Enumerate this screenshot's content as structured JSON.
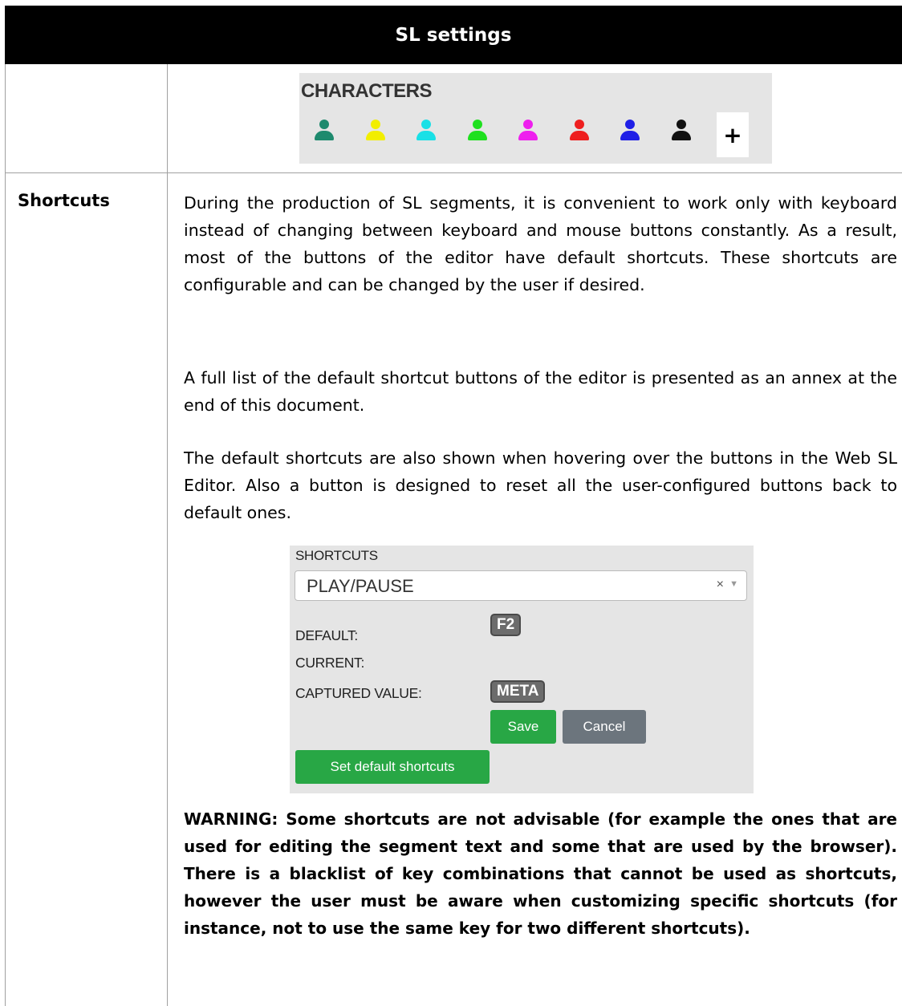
{
  "header": {
    "title": "SL settings"
  },
  "characters": {
    "title": "CHARACTERS",
    "icon": "user-icon",
    "colors": [
      "#1e8a6e",
      "#f2ee00",
      "#19e0e6",
      "#1fe01f",
      "#ee1fee",
      "#ee1f1f",
      "#1f1fe6",
      "#111111"
    ],
    "add_label": "+"
  },
  "shortcuts_row": {
    "label": "Shortcuts",
    "paragraphs": [
      "During the production of SL segments, it is convenient to work only with keyboard instead of changing between keyboard and mouse buttons constantly. As a result, most of the buttons of the editor have default shortcuts. These shortcuts are configurable and can be changed by the user if desired.",
      "A full list of the default shortcut buttons of the editor is presented as an annex at the end of this document.",
      "The default shortcuts are also shown when hovering over the buttons in the Web SL Editor. Also a button is designed to reset all the user-configured buttons back to default ones."
    ],
    "warning": "WARNING: Some shortcuts are not advisable (for example the ones that are used for editing the segment text and some that are used by the browser). There is a blacklist of key combinations that cannot be used as shortcuts, however the user must be aware when customizing specific shortcuts (for instance, not to use the same key for two different shortcuts)."
  },
  "shortcuts_panel": {
    "title": "SHORTCUTS",
    "selected": "PLAY/PAUSE",
    "clear": "×",
    "caret": "▼",
    "default_label": "DEFAULT:",
    "default_key": "F2",
    "current_label": "CURRENT:",
    "captured_label": "CAPTURED VALUE:",
    "captured_key": "META",
    "save": "Save",
    "cancel": "Cancel",
    "reset": "Set default shortcuts"
  }
}
